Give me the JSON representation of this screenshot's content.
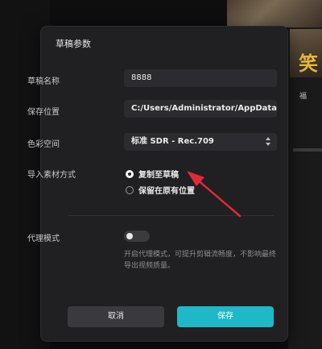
{
  "background": {
    "overlay_char": "笑",
    "overlay_small": "福"
  },
  "dialog": {
    "title": "草稿参数",
    "draft_name": {
      "label": "草稿名称",
      "value": "8888"
    },
    "save_location": {
      "label": "保存位置",
      "value": "C:/Users/Administrator/AppData..."
    },
    "color_space": {
      "label": "色彩空间",
      "value": "标准 SDR - Rec.709"
    },
    "import_mode": {
      "label": "导入素材方式",
      "options": [
        {
          "label": "复制至草稿",
          "selected": true
        },
        {
          "label": "保留在原有位置",
          "selected": false
        }
      ]
    },
    "proxy_mode": {
      "label": "代理模式",
      "enabled": false,
      "hint": "开启代理模式，可提升剪辑流畅度，不影响最终导出视频质量。"
    },
    "cancel_label": "取消",
    "save_label": "保存"
  },
  "colors": {
    "accent": "#1fb8c8",
    "arrow": "#e0293a",
    "dialog_bg": "#202022"
  }
}
